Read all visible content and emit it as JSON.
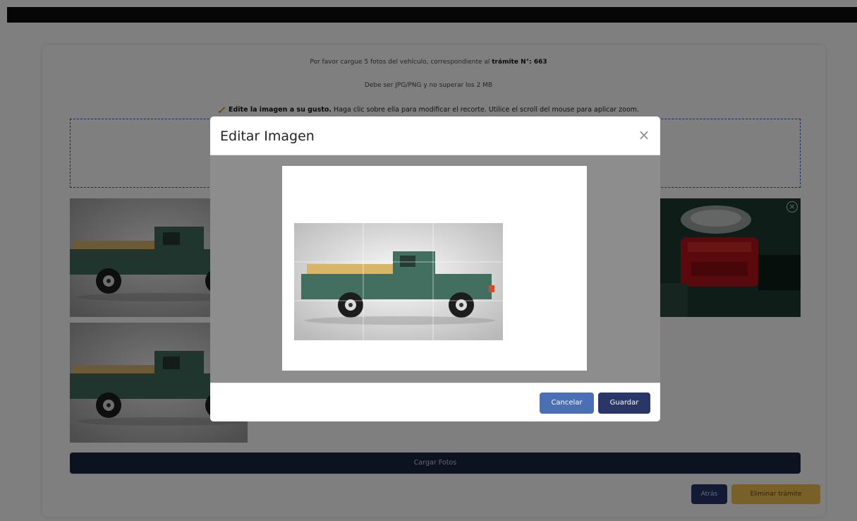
{
  "page": {
    "instruction_prefix": "Por favor cargue 5 fotos del vehículo, correspondiente al ",
    "instruction_strong": "trámite N°: 663",
    "format_note": "Debe ser JPG/PNG y no superar los 2 MB",
    "edit_hint_strong": "Edite la imagen a su gusto.",
    "edit_hint_rest": " Haga clic sobre ella para modificar el recorte. Utilice el scroll del mouse para aplicar zoom.",
    "upload_label": "Cargar Fotos",
    "back_label": "Atrás",
    "delete_label": "Eliminar trámite"
  },
  "modal": {
    "title": "Editar Imagen",
    "close_symbol": "×",
    "cancel_label": "Cancelar",
    "save_label": "Guardar"
  },
  "thumbnails": [
    {
      "name": "photo-truck-side-1",
      "subject": "green pickup truck side view"
    },
    {
      "name": "photo-truck-side-2",
      "subject": "green pickup truck side view"
    },
    {
      "name": "photo-engine",
      "subject": "red engine bay"
    }
  ],
  "icons": {
    "pencil": "pencil-icon",
    "remove": "remove-circle-icon",
    "close": "close-icon"
  },
  "colors": {
    "primary_dark": "#1b2540",
    "button_navy": "#27356b",
    "button_blue": "#4a6fb4",
    "warning": "#f2be50",
    "dropzone_border": "#2f5cae"
  }
}
